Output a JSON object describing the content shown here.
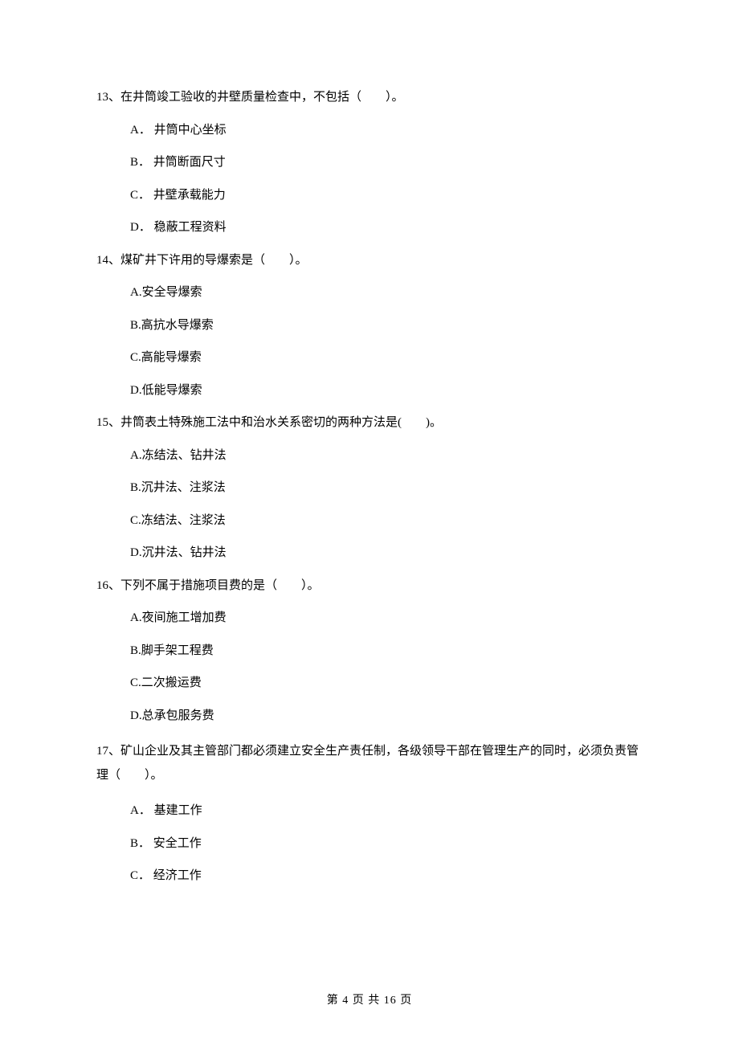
{
  "questions": [
    {
      "num": "13、",
      "stem": "在井筒竣工验收的井壁质量检查中，不包括（　　）。",
      "options": [
        "A．  井筒中心坐标",
        "B．  井筒断面尺寸",
        "C．  井壁承载能力",
        "D．  稳蔽工程资料"
      ]
    },
    {
      "num": "14、",
      "stem": "煤矿井下许用的导爆索是（　　）。",
      "options": [
        "A.安全导爆索",
        "B.高抗水导爆索",
        "C.高能导爆索",
        "D.低能导爆索"
      ]
    },
    {
      "num": "15、",
      "stem": "井筒表土特殊施工法中和治水关系密切的两种方法是(　　)。",
      "options": [
        "A.冻结法、钻井法",
        "B.沉井法、注浆法",
        "C.冻结法、注浆法",
        "D.沉井法、钻井法"
      ]
    },
    {
      "num": "16、",
      "stem": "下列不属于措施项目费的是（　　）。",
      "options": [
        "A.夜间施工增加费",
        "B.脚手架工程费",
        "C.二次搬运费",
        "D.总承包服务费"
      ]
    },
    {
      "num": "17、",
      "stem": "矿山企业及其主管部门都必须建立安全生产责任制，各级领导干部在管理生产的同时，必须负责管理（　　）。",
      "options": [
        "A．  基建工作",
        "B．  安全工作",
        "C．  经济工作"
      ]
    }
  ],
  "footer": "第 4 页 共 16 页"
}
